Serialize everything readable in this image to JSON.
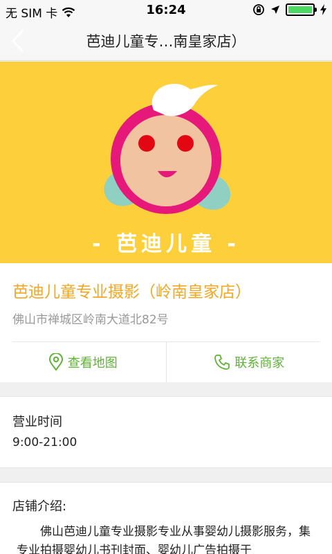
{
  "status_bar": {
    "carrier": "无 SIM 卡",
    "time": "16:24",
    "battery_level": 1.0
  },
  "nav": {
    "title": "芭迪儿童专…南皇家店）",
    "back_icon": "chevron-left-icon"
  },
  "banner": {
    "background_color": "#fdd03b",
    "brand_text": "- 芭迪儿童 -"
  },
  "store": {
    "name": "芭迪儿童专业摄影（岭南皇家店）",
    "address": "佛山市禅城区岭南大道北82号",
    "accent_color": "#f5a623"
  },
  "actions": {
    "map_label": "查看地图",
    "map_icon": "location-pin-icon",
    "contact_label": "联系商家",
    "contact_icon": "phone-icon",
    "color": "#5fb336"
  },
  "hours": {
    "title": "营业时间",
    "value": "9:00-21:00"
  },
  "intro": {
    "title": "店铺介绍:",
    "text": "佛山芭迪儿童专业摄影专业从事婴幼儿摄影服务，集专业拍摄婴幼儿书刊封面、婴幼儿广告拍摄于"
  }
}
